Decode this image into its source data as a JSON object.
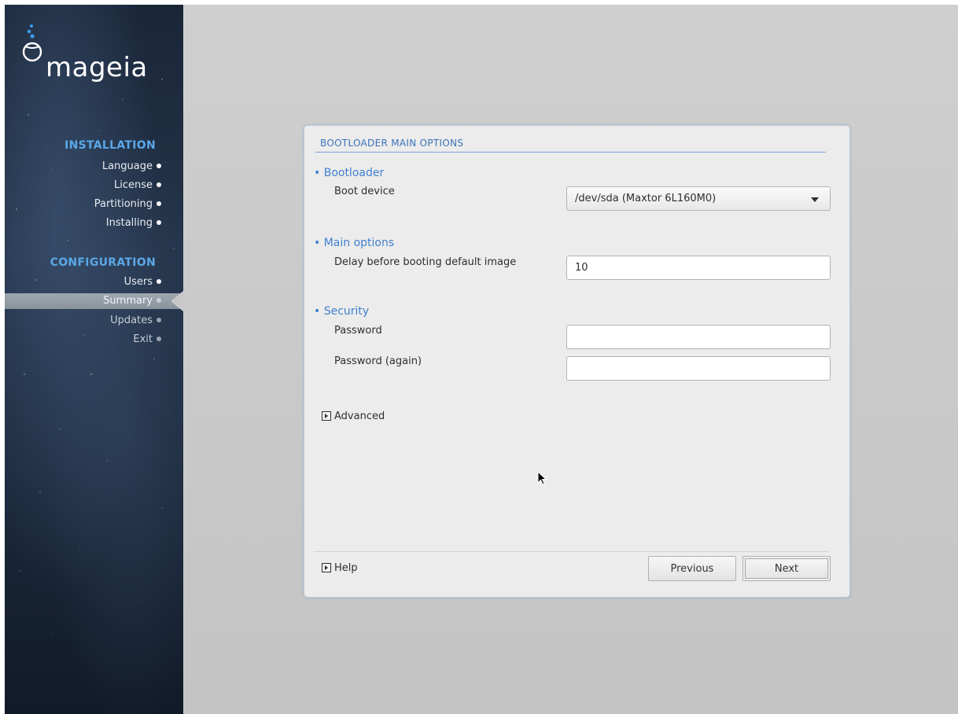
{
  "brand": {
    "logo_text": "mageia"
  },
  "sidebar": {
    "installation_title": "INSTALLATION",
    "configuration_title": "CONFIGURATION",
    "installation_steps": [
      "Language",
      "License",
      "Partitioning",
      "Installing"
    ],
    "configuration_steps": [
      "Users",
      "Summary",
      "Updates",
      "Exit"
    ],
    "active_step": "Summary"
  },
  "dialog": {
    "title": "BOOTLOADER MAIN OPTIONS",
    "bootloader": {
      "group_label": "• Bootloader",
      "boot_device_label": "Boot device",
      "boot_device_value": "/dev/sda (Maxtor 6L160M0)"
    },
    "main_options": {
      "group_label": "• Main options",
      "delay_label": "Delay before booting default image",
      "delay_value": "10"
    },
    "security": {
      "group_label": "• Security",
      "password_label": "Password",
      "password_value": "",
      "password_again_label": "Password (again)",
      "password_again_value": ""
    },
    "advanced_label": "Advanced",
    "help_label": "Help",
    "previous_label": "Previous",
    "next_label": "Next"
  },
  "colors": {
    "accent_blue": "#3f7fcf",
    "sidebar_title": "#5aa8e6",
    "dialog_bg": "#ececec",
    "desktop_bg": "#c8c8c8"
  }
}
